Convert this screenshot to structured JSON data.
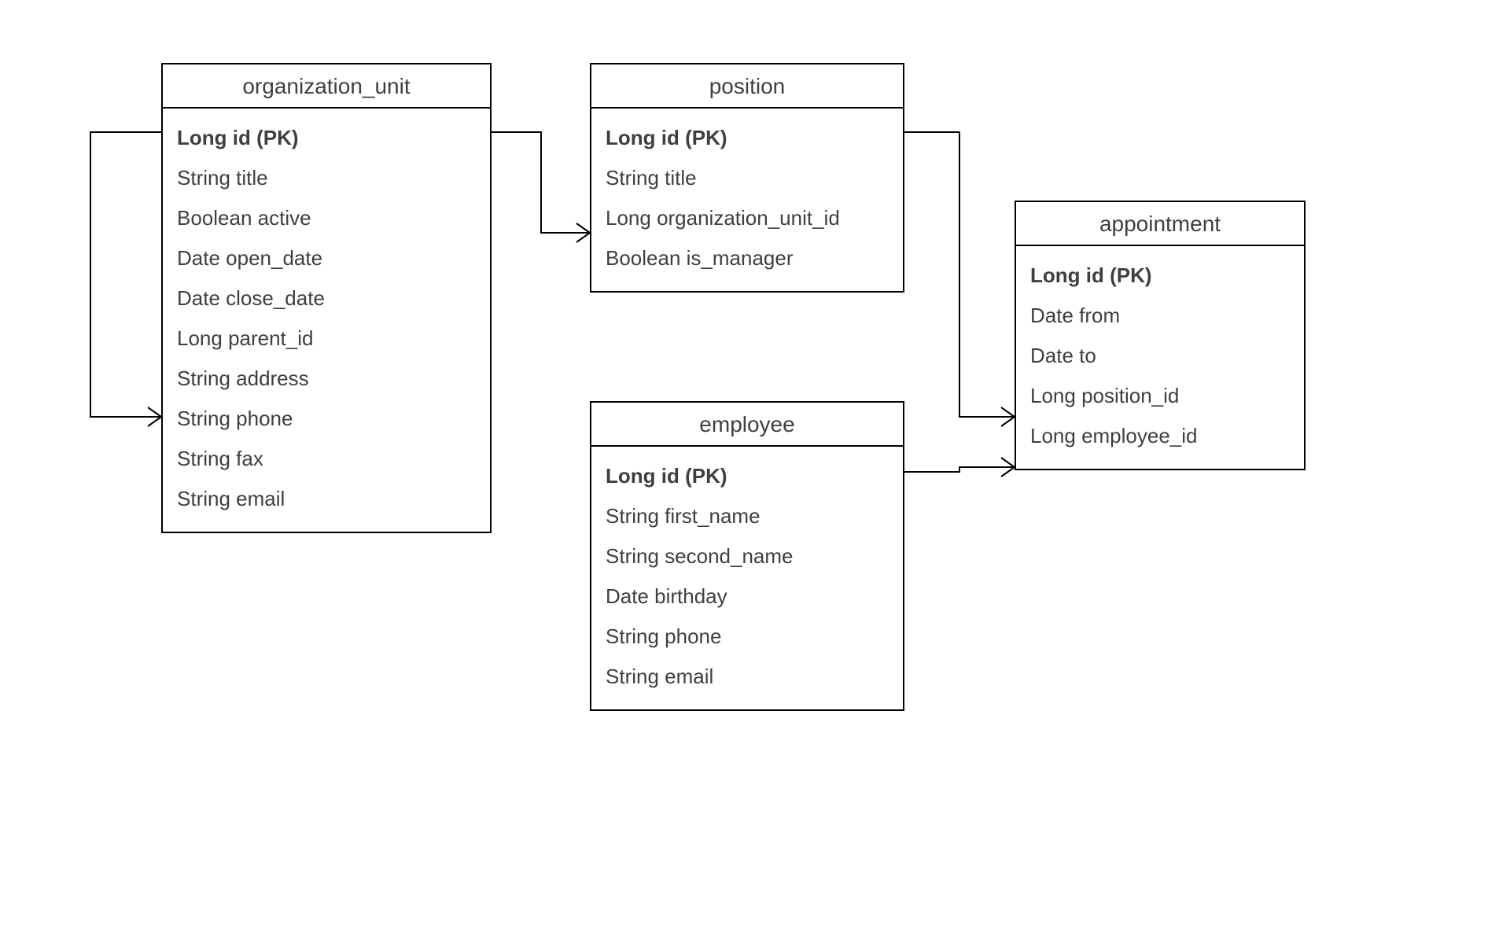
{
  "entities": {
    "organization_unit": {
      "title": "organization_unit",
      "attrs": [
        {
          "text": "Long id (PK)",
          "pk": true
        },
        {
          "text": "String title"
        },
        {
          "text": "Boolean active"
        },
        {
          "text": "Date open_date"
        },
        {
          "text": "Date close_date"
        },
        {
          "text": "Long parent_id"
        },
        {
          "text": "String address"
        },
        {
          "text": "String phone"
        },
        {
          "text": "String fax"
        },
        {
          "text": "String email"
        }
      ]
    },
    "position": {
      "title": "position",
      "attrs": [
        {
          "text": "Long id (PK)",
          "pk": true
        },
        {
          "text": "String title"
        },
        {
          "text": "Long organization_unit_id"
        },
        {
          "text": "Boolean is_manager"
        }
      ]
    },
    "employee": {
      "title": "employee",
      "attrs": [
        {
          "text": "Long id (PK)",
          "pk": true
        },
        {
          "text": "String first_name"
        },
        {
          "text": "String second_name"
        },
        {
          "text": "Date birthday"
        },
        {
          "text": "String phone"
        },
        {
          "text": "String email"
        }
      ]
    },
    "appointment": {
      "title": "appointment",
      "attrs": [
        {
          "text": "Long id (PK)",
          "pk": true
        },
        {
          "text": "Date from"
        },
        {
          "text": "Date to"
        },
        {
          "text": "Long position_id"
        },
        {
          "text": "Long employee_id"
        }
      ]
    }
  },
  "relationships": [
    {
      "from": "organization_unit.id",
      "to": "organization_unit.parent_id",
      "type": "one-to-many",
      "note": "self-reference"
    },
    {
      "from": "organization_unit.id",
      "to": "position.organization_unit_id",
      "type": "one-to-many"
    },
    {
      "from": "position.id",
      "to": "appointment.position_id",
      "type": "one-to-many"
    },
    {
      "from": "employee.id",
      "to": "appointment.employee_id",
      "type": "one-to-many"
    }
  ]
}
